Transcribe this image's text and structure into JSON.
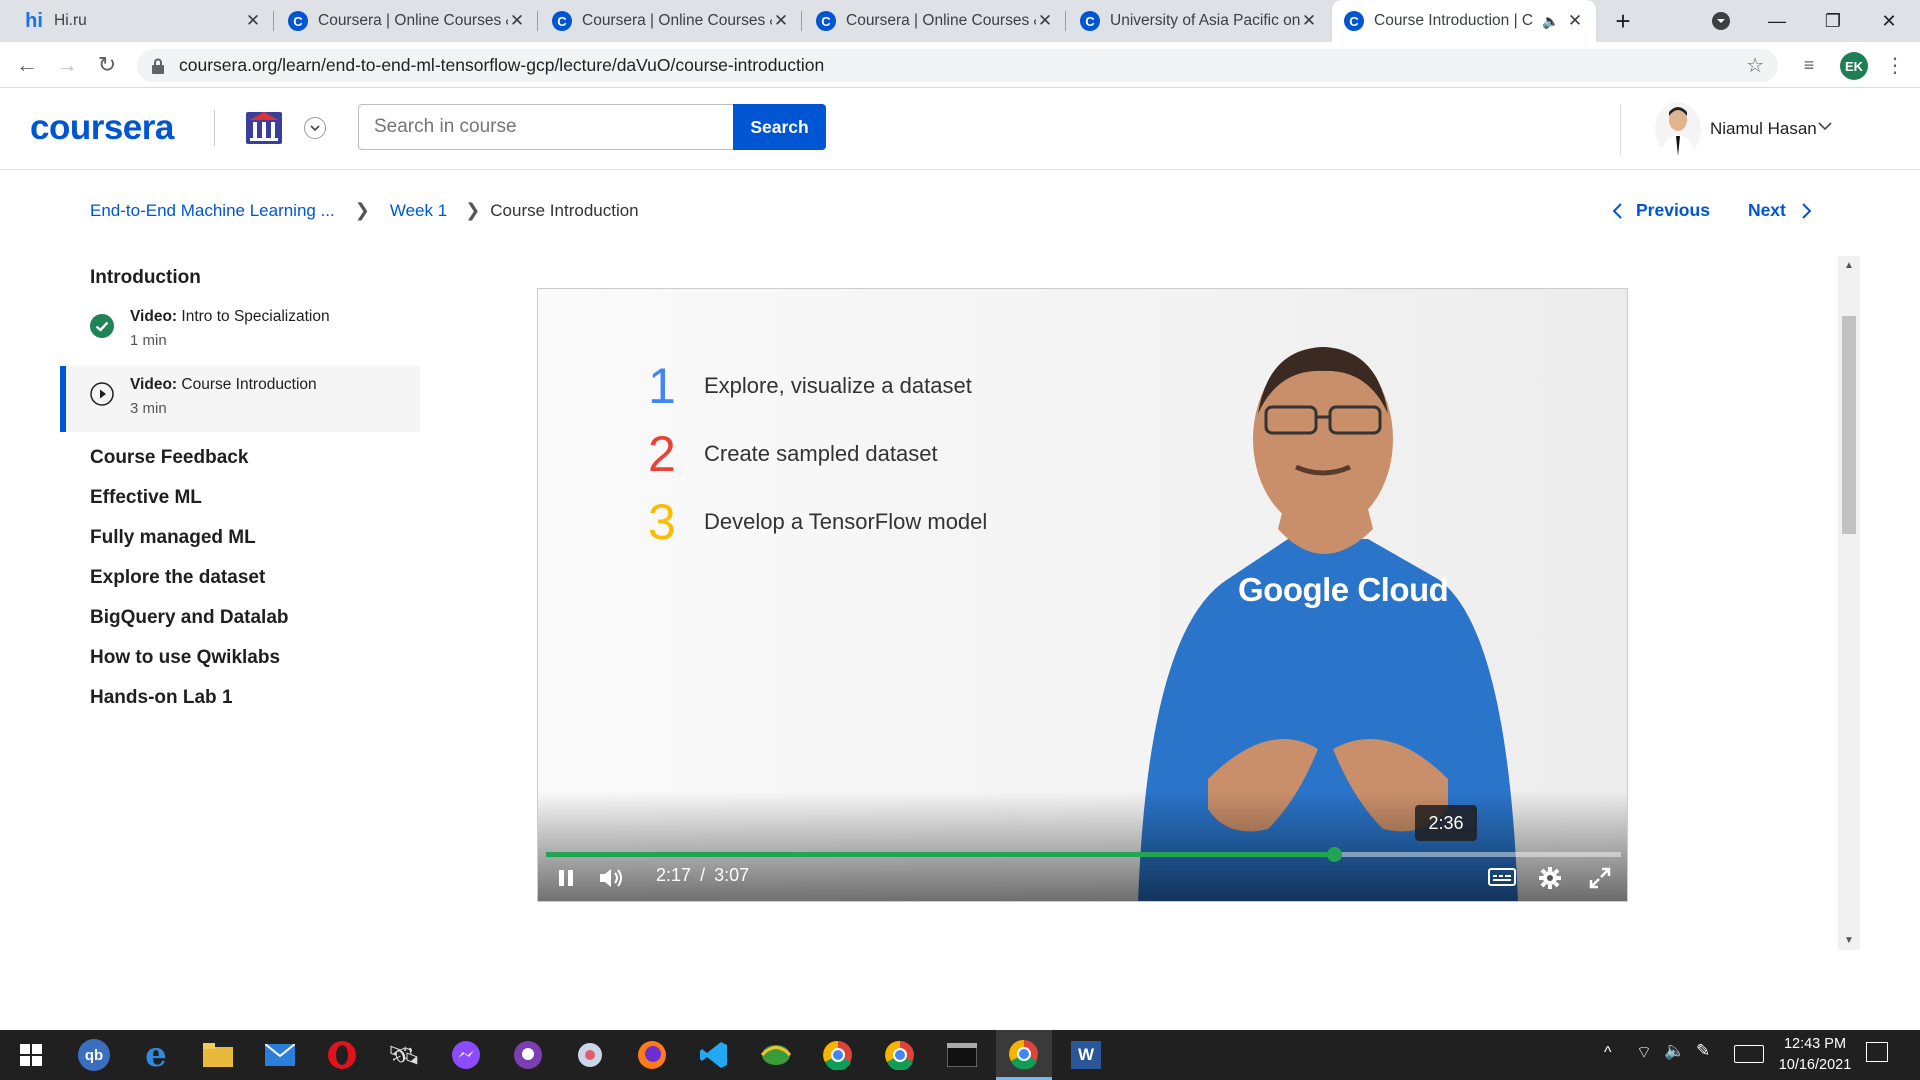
{
  "browser": {
    "tabs": [
      {
        "title": "Hi.ru",
        "favicon": "hi-ru-icon"
      },
      {
        "title": "Coursera | Online Courses &",
        "favicon": "coursera-icon"
      },
      {
        "title": "Coursera | Online Courses &",
        "favicon": "coursera-icon"
      },
      {
        "title": "Coursera | Online Courses &",
        "favicon": "coursera-icon"
      },
      {
        "title": "University of Asia Pacific on",
        "favicon": "coursera-icon"
      },
      {
        "title": "Course Introduction | C",
        "favicon": "coursera-icon",
        "active": true,
        "audio": true
      }
    ],
    "url": "coursera.org/learn/end-to-end-ml-tensorflow-gcp/lecture/daVuO/course-introduction",
    "profile_initials": "EK"
  },
  "header": {
    "logo": "coursera",
    "search_placeholder": "Search in course",
    "search_button": "Search",
    "user_name": "Niamul Hasan"
  },
  "breadcrumb": {
    "course": "End-to-End Machine Learning ...",
    "week": "Week 1",
    "current": "Course Introduction"
  },
  "nav": {
    "previous": "Previous",
    "next": "Next"
  },
  "sidebar": {
    "section_title": "Introduction",
    "items": [
      {
        "kind": "Video:",
        "title": "Intro to Specialization",
        "duration": "1 min",
        "status": "completed"
      },
      {
        "kind": "Video:",
        "title": "Course Introduction",
        "duration": "3 min",
        "status": "current"
      }
    ],
    "sections": [
      "Course Feedback",
      "Effective ML",
      "Fully managed ML",
      "Explore the dataset",
      "BigQuery and Datalab",
      "How to use Qwiklabs",
      "Hands-on Lab 1"
    ]
  },
  "video": {
    "slide_points": [
      {
        "num": "1",
        "text": "Explore, visualize a dataset",
        "color": "#4285f4"
      },
      {
        "num": "2",
        "text": "Create sampled dataset",
        "color": "#ea4335"
      },
      {
        "num": "3",
        "text": "Develop a TensorFlow model",
        "color": "#fbbc05"
      }
    ],
    "shirt_text": "Google Cloud",
    "current_time": "2:17",
    "separator": "/",
    "duration": "3:07",
    "hover_time": "2:36",
    "progress_fraction": 0.733,
    "accent": "#21a453"
  },
  "taskbar": {
    "time": "12:43 PM",
    "date": "10/16/2021"
  }
}
